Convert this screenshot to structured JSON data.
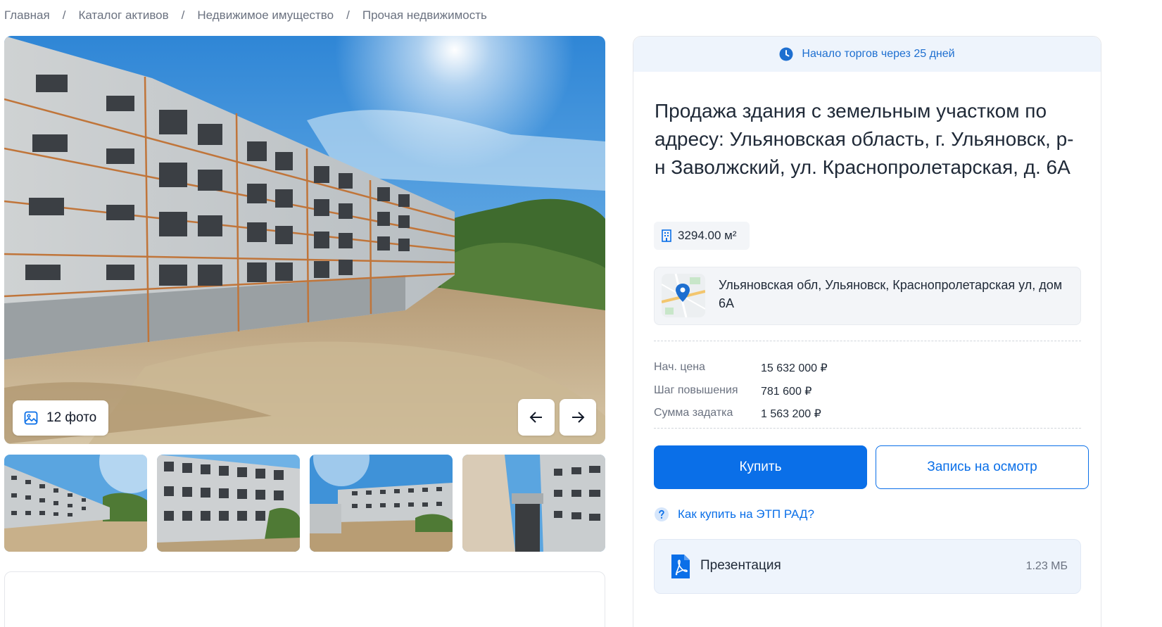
{
  "breadcrumb": {
    "items": [
      "Главная",
      "Каталог активов",
      "Недвижимое имущество",
      "Прочая недвижимость"
    ],
    "separator": "/"
  },
  "gallery": {
    "photo_count_label": "12 фото",
    "icons": {
      "photos": "image-icon",
      "prev": "arrow-left-icon",
      "next": "arrow-right-icon"
    }
  },
  "lot": {
    "auction_banner": "Начало торгов через 25 дней",
    "title": "Продажа здания с земельным участком по адресу: Ульяновская область, г. Ульяновск, р-н Заволжский, ул. Краснопролетарская, д. 6А",
    "area": "3294.00 м²",
    "address": "Ульяновская обл, Ульяновск, Краснопролетарская ул, дом 6А",
    "prices": [
      {
        "label": "Нач. цена",
        "value": "15 632 000 ₽"
      },
      {
        "label": "Шаг повышения",
        "value": "781 600 ₽"
      },
      {
        "label": "Сумма задатка",
        "value": "1 563 200 ₽"
      }
    ],
    "buy_label": "Купить",
    "viewing_label": "Запись на осмотр",
    "how_to_buy_label": "Как купить на ЭТП РАД?",
    "document": {
      "title": "Презентация",
      "size": "1.23 МБ"
    }
  },
  "colors": {
    "accent": "#0a6fe8",
    "banner_bg": "#eef4fc",
    "card_bg": "#f3f5f8",
    "muted_text": "#6b7280"
  }
}
